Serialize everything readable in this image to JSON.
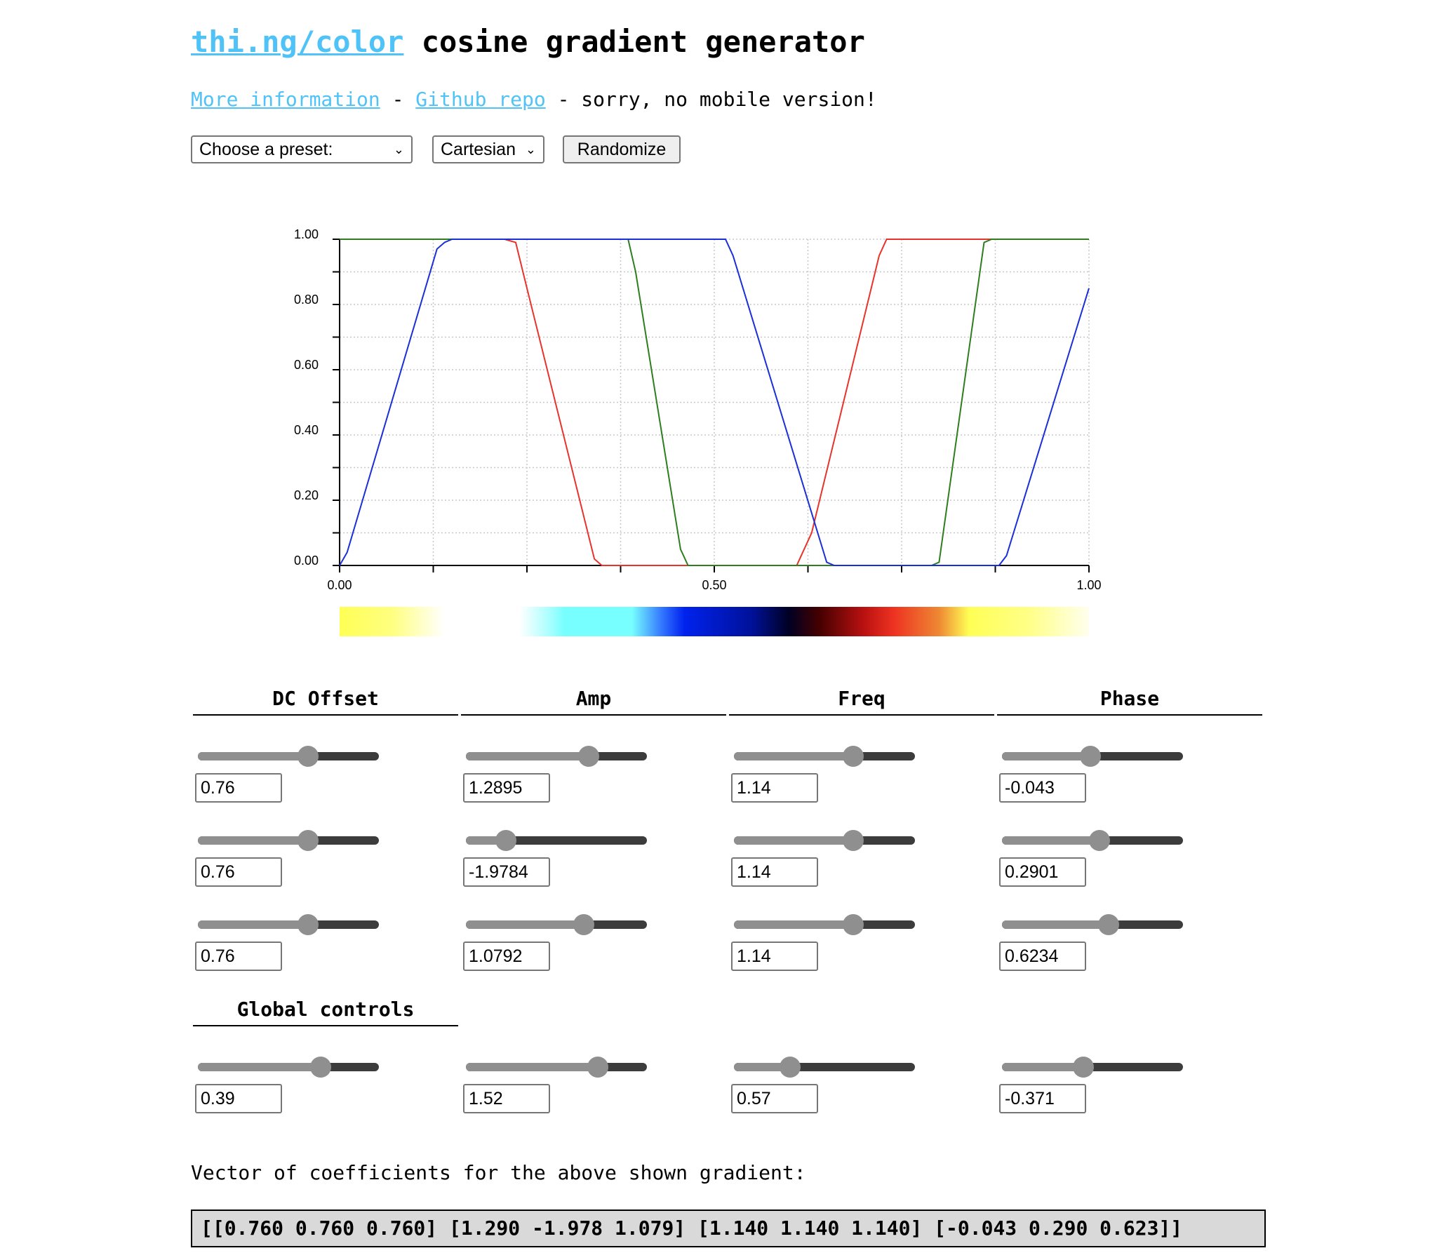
{
  "header": {
    "title_link": "thi.ng/color",
    "title_rest": " cosine gradient generator",
    "more_info": "More information",
    "sep1": " - ",
    "github": "Github repo",
    "note": " - sorry, no mobile version!"
  },
  "controls": {
    "preset": "Choose a preset:",
    "mode": "Cartesian",
    "randomize": "Randomize"
  },
  "chart_data": {
    "type": "line",
    "xlim": [
      0,
      1
    ],
    "ylim": [
      0,
      1
    ],
    "xticks": [
      "0.00",
      "0.50",
      "1.00"
    ],
    "yticks": [
      "0.00",
      "0.20",
      "0.40",
      "0.60",
      "0.80",
      "1.00"
    ],
    "grid": true,
    "series": [
      {
        "color": "#e8332a",
        "points": [
          [
            0,
            1
          ],
          [
            0.22,
            1
          ],
          [
            0.235,
            0.99
          ],
          [
            0.25,
            0.85
          ],
          [
            0.34,
            0.02
          ],
          [
            0.35,
            0
          ],
          [
            0.61,
            0
          ],
          [
            0.63,
            0.1
          ],
          [
            0.72,
            0.95
          ],
          [
            0.73,
            1
          ],
          [
            1,
            1
          ]
        ]
      },
      {
        "color": "#2e7d1f",
        "points": [
          [
            0,
            1
          ],
          [
            0.385,
            1
          ],
          [
            0.395,
            0.9
          ],
          [
            0.455,
            0.05
          ],
          [
            0.465,
            0
          ],
          [
            0.79,
            0
          ],
          [
            0.8,
            0.01
          ],
          [
            0.86,
            0.99
          ],
          [
            0.87,
            1
          ],
          [
            1,
            1
          ]
        ]
      },
      {
        "color": "#1a2fd6",
        "points": [
          [
            0,
            0
          ],
          [
            0.01,
            0.04
          ],
          [
            0.13,
            0.97
          ],
          [
            0.14,
            0.99
          ],
          [
            0.15,
            1
          ],
          [
            0.515,
            1
          ],
          [
            0.525,
            0.95
          ],
          [
            0.65,
            0.01
          ],
          [
            0.66,
            0
          ],
          [
            0.88,
            0
          ],
          [
            0.89,
            0.03
          ],
          [
            1,
            0.85
          ]
        ]
      }
    ]
  },
  "gradient": {
    "stops": [
      {
        "pos": 0,
        "color": "#ffff55"
      },
      {
        "pos": 0.07,
        "color": "#ffff80"
      },
      {
        "pos": 0.14,
        "color": "#ffffff"
      },
      {
        "pos": 0.24,
        "color": "#ffffff"
      },
      {
        "pos": 0.28,
        "color": "#aaffff"
      },
      {
        "pos": 0.3,
        "color": "#77ffff"
      },
      {
        "pos": 0.39,
        "color": "#77ffff"
      },
      {
        "pos": 0.43,
        "color": "#3377ff"
      },
      {
        "pos": 0.46,
        "color": "#0022ee"
      },
      {
        "pos": 0.55,
        "color": "#001199"
      },
      {
        "pos": 0.6,
        "color": "#000022"
      },
      {
        "pos": 0.64,
        "color": "#440000"
      },
      {
        "pos": 0.7,
        "color": "#bb1111"
      },
      {
        "pos": 0.74,
        "color": "#ee3322"
      },
      {
        "pos": 0.8,
        "color": "#ee8833"
      },
      {
        "pos": 0.84,
        "color": "#ffff55"
      },
      {
        "pos": 0.92,
        "color": "#ffff88"
      },
      {
        "pos": 1,
        "color": "#ffffee"
      }
    ]
  },
  "columns": [
    {
      "label": "DC Offset",
      "values": [
        "0.76",
        "0.76",
        "0.76"
      ],
      "levels": [
        0.61,
        0.61,
        0.61
      ]
    },
    {
      "label": "Amp",
      "values": [
        "1.2895",
        "-1.9784",
        "1.0792"
      ],
      "levels": [
        0.68,
        0.22,
        0.65
      ]
    },
    {
      "label": "Freq",
      "values": [
        "1.14",
        "1.14",
        "1.14"
      ],
      "levels": [
        0.66,
        0.66,
        0.66
      ]
    },
    {
      "label": "Phase",
      "values": [
        "-0.043",
        "0.2901",
        "0.6234"
      ],
      "levels": [
        0.49,
        0.54,
        0.59
      ]
    }
  ],
  "global": {
    "label": "Global controls",
    "values": [
      "0.39",
      "1.52",
      "0.57",
      "-0.371"
    ],
    "levels": [
      0.68,
      0.73,
      0.31,
      0.45
    ]
  },
  "vector": {
    "label": "Vector of coefficients for the above shown gradient:",
    "text": "[[0.760 0.760 0.760] [1.290 -1.978 1.079] [1.140 1.140 1.140] [-0.043 0.290 0.623]]"
  }
}
